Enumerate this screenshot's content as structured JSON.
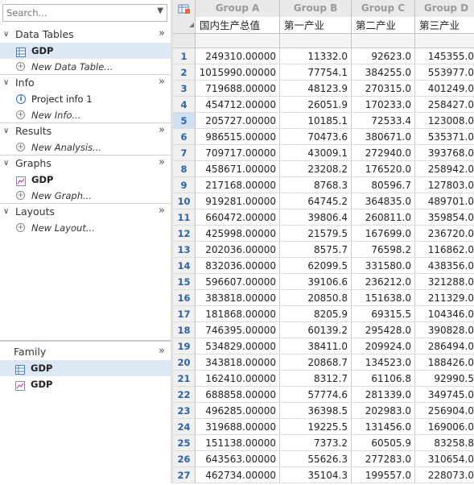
{
  "navigator": {
    "search_placeholder": "Search...",
    "sections": [
      {
        "title": "Data Tables",
        "items": [
          {
            "label": "GDP",
            "icon": "table-icon",
            "selected": true,
            "style": "bold"
          },
          {
            "label": "New Data Table...",
            "icon": "add-icon",
            "style": "italic"
          }
        ]
      },
      {
        "title": "Info",
        "items": [
          {
            "label": "Project info 1",
            "icon": "info-icon",
            "style": "normal"
          },
          {
            "label": "New Info...",
            "icon": "add-icon",
            "style": "italic"
          }
        ]
      },
      {
        "title": "Results",
        "items": [
          {
            "label": "New Analysis...",
            "icon": "add-icon",
            "style": "italic"
          }
        ]
      },
      {
        "title": "Graphs",
        "items": [
          {
            "label": "GDP",
            "icon": "graph-icon",
            "style": "bold"
          },
          {
            "label": "New Graph...",
            "icon": "add-icon",
            "style": "italic"
          }
        ]
      },
      {
        "title": "Layouts",
        "items": [
          {
            "label": "New Layout...",
            "icon": "add-icon",
            "style": "italic"
          }
        ]
      }
    ],
    "family": {
      "title": "Family",
      "items": [
        {
          "label": "GDP",
          "icon": "table-icon",
          "selected": true
        },
        {
          "label": "GDP",
          "icon": "graph-icon"
        }
      ]
    }
  },
  "grid": {
    "columns": [
      {
        "group": "Group A",
        "title": "国内生产总值"
      },
      {
        "group": "Group B",
        "title": "第一产业"
      },
      {
        "group": "Group C",
        "title": "第二产业"
      },
      {
        "group": "Group D",
        "title": "第三产业"
      }
    ],
    "active_row": 5,
    "rows": [
      [
        "249310.00000",
        "11332.0",
        "92623.0",
        "145355.0"
      ],
      [
        "1015990.00000",
        "77754.1",
        "384255.0",
        "553977.0"
      ],
      [
        "719688.00000",
        "48123.9",
        "270315.0",
        "401249.0"
      ],
      [
        "454712.00000",
        "26051.9",
        "170233.0",
        "258427.0"
      ],
      [
        "205727.00000",
        "10185.1",
        "72533.4",
        "123008.0"
      ],
      [
        "986515.00000",
        "70473.6",
        "380671.0",
        "535371.0"
      ],
      [
        "709717.00000",
        "43009.1",
        "272940.0",
        "393768.0"
      ],
      [
        "458671.00000",
        "23208.2",
        "176520.0",
        "258942.0"
      ],
      [
        "217168.00000",
        "8768.3",
        "80596.7",
        "127803.0"
      ],
      [
        "919281.00000",
        "64745.2",
        "364835.0",
        "489701.0"
      ],
      [
        "660472.00000",
        "39806.4",
        "260811.0",
        "359854.0"
      ],
      [
        "425998.00000",
        "21579.5",
        "167699.0",
        "236720.0"
      ],
      [
        "202036.00000",
        "8575.7",
        "76598.2",
        "116862.0"
      ],
      [
        "832036.00000",
        "62099.5",
        "331580.0",
        "438356.0"
      ],
      [
        "596607.00000",
        "39106.6",
        "236212.0",
        "321288.0"
      ],
      [
        "383818.00000",
        "20850.8",
        "151638.0",
        "211329.0"
      ],
      [
        "181868.00000",
        "8205.9",
        "69315.5",
        "104346.0"
      ],
      [
        "746395.00000",
        "60139.2",
        "295428.0",
        "390828.0"
      ],
      [
        "534829.00000",
        "38411.0",
        "209924.0",
        "286494.0"
      ],
      [
        "343818.00000",
        "20868.7",
        "134523.0",
        "188426.0"
      ],
      [
        "162410.00000",
        "8312.7",
        "61106.8",
        "92990.5"
      ],
      [
        "688858.00000",
        "57774.6",
        "281339.0",
        "349745.0"
      ],
      [
        "496285.00000",
        "36398.5",
        "202983.0",
        "256904.0"
      ],
      [
        "319688.00000",
        "19225.5",
        "131456.0",
        "169006.0"
      ],
      [
        "151138.00000",
        "7373.2",
        "60505.9",
        "83258.8"
      ],
      [
        "643563.00000",
        "55626.3",
        "277283.0",
        "310654.0"
      ],
      [
        "462734.00000",
        "35104.3",
        "199557.0",
        "228073.0"
      ]
    ]
  }
}
